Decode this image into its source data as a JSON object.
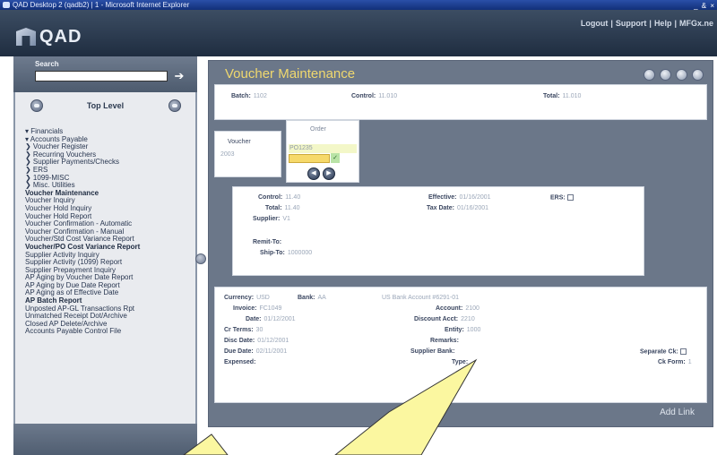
{
  "window": {
    "title": "QAD Desktop 2 (qadb2) | 1 - Microsoft Internet Explorer",
    "controls": "_ & ×"
  },
  "header": {
    "logo_text": "QAD",
    "links": [
      "Logout",
      "Support",
      "Help",
      "MFGx.ne"
    ]
  },
  "sidebar": {
    "search_label": "Search",
    "search_value": "",
    "menu_title": "Top Level",
    "items": [
      {
        "label": "▾ Financials",
        "bold": false
      },
      {
        "label": "▾ Accounts Payable",
        "bold": false
      },
      {
        "label": "❯ Voucher Register",
        "bold": false
      },
      {
        "label": "❯ Recurring Vouchers",
        "bold": false
      },
      {
        "label": "❯ Supplier Payments/Checks",
        "bold": false
      },
      {
        "label": "❯ ERS",
        "bold": false
      },
      {
        "label": "❯ 1099-MISC",
        "bold": false
      },
      {
        "label": "❯ Misc. Utilities",
        "bold": false
      },
      {
        "label": "Voucher Maintenance",
        "bold": true
      },
      {
        "label": "Voucher Inquiry",
        "bold": false
      },
      {
        "label": "Voucher Hold Inquiry",
        "bold": false
      },
      {
        "label": "Voucher Hold Report",
        "bold": false
      },
      {
        "label": "Voucher Confirmation - Automatic",
        "bold": false
      },
      {
        "label": "Voucher Confirmation - Manual",
        "bold": false
      },
      {
        "label": "Voucher/Std Cost Variance Report",
        "bold": false
      },
      {
        "label": "Voucher/PO Cost Variance Report",
        "bold": true
      },
      {
        "label": "Supplier Activity Inquiry",
        "bold": false
      },
      {
        "label": "Supplier Activity (1099) Report",
        "bold": false
      },
      {
        "label": "Supplier Prepayment Inquiry",
        "bold": false
      },
      {
        "label": "AP Aging by Voucher Date Report",
        "bold": false
      },
      {
        "label": "AP Aging by Due Date Report",
        "bold": false
      },
      {
        "label": "AP Aging as of Effective Date",
        "bold": false
      },
      {
        "label": "AP Batch Report",
        "bold": true
      },
      {
        "label": "Unposted AP-GL Transactions Rpt",
        "bold": false
      },
      {
        "label": "Unmatched Receipt Dot/Archive",
        "bold": false
      },
      {
        "label": "Closed AP Delete/Archive",
        "bold": false
      },
      {
        "label": "Accounts Payable Control File",
        "bold": false
      }
    ]
  },
  "main": {
    "title": "Voucher Maintenance",
    "batch": {
      "batch_label": "Batch:",
      "batch_value": "1102",
      "control_label": "Control:",
      "control_value": "11.010",
      "total_label": "Total:",
      "total_value": "11.010"
    },
    "tabs": {
      "voucher_label": "Voucher",
      "voucher_value": "2003",
      "order_label": "Order",
      "order_value": "PO1235",
      "order_input": "",
      "order_check": "✓"
    },
    "totals": {
      "control_label": "Control:",
      "control_value": "11.40",
      "total_label": "Total:",
      "total_value": "11.40",
      "supplier_label": "Supplier:",
      "supplier_value": "V1",
      "effective_label": "Effective:",
      "effective_value": "01/16/2001",
      "tax_date_label": "Tax Date:",
      "tax_date_value": "01/16/2001",
      "ers_label": "ERS:",
      "remit_label": "Remit-To:",
      "remit_value": "",
      "ship_label": "Ship-To:",
      "ship_value": "1000000"
    },
    "detail": {
      "currency_label": "Currency:",
      "currency_value": "USD",
      "bank_label": "Bank:",
      "bank_value": "AA",
      "bank_note": "US Bank Account #6291-01",
      "invoice_label": "Invoice:",
      "invoice_value": "FC1049",
      "date_label": "Date:",
      "date_value": "01/12/2001",
      "cr_terms_label": "Cr Terms:",
      "cr_terms_value": "30",
      "disc_date_label": "Disc Date:",
      "disc_date_value": "01/12/2001",
      "due_date_label": "Due Date:",
      "due_date_value": "02/11/2001",
      "expensed_label": "Expensed:",
      "account_label": "Account:",
      "account_value": "2100",
      "discount_acct_label": "Discount Acct:",
      "discount_acct_value": "2210",
      "entity_label": "Entity:",
      "entity_value": "1000",
      "remarks_label": "Remarks:",
      "supplier_bank_label": "Supplier Bank:",
      "type_label": "Type:",
      "separate_ck_label": "Separate Ck:",
      "ck_form_label": "Ck Form:",
      "ck_form_value": "1"
    },
    "add_link": "Add Link"
  }
}
